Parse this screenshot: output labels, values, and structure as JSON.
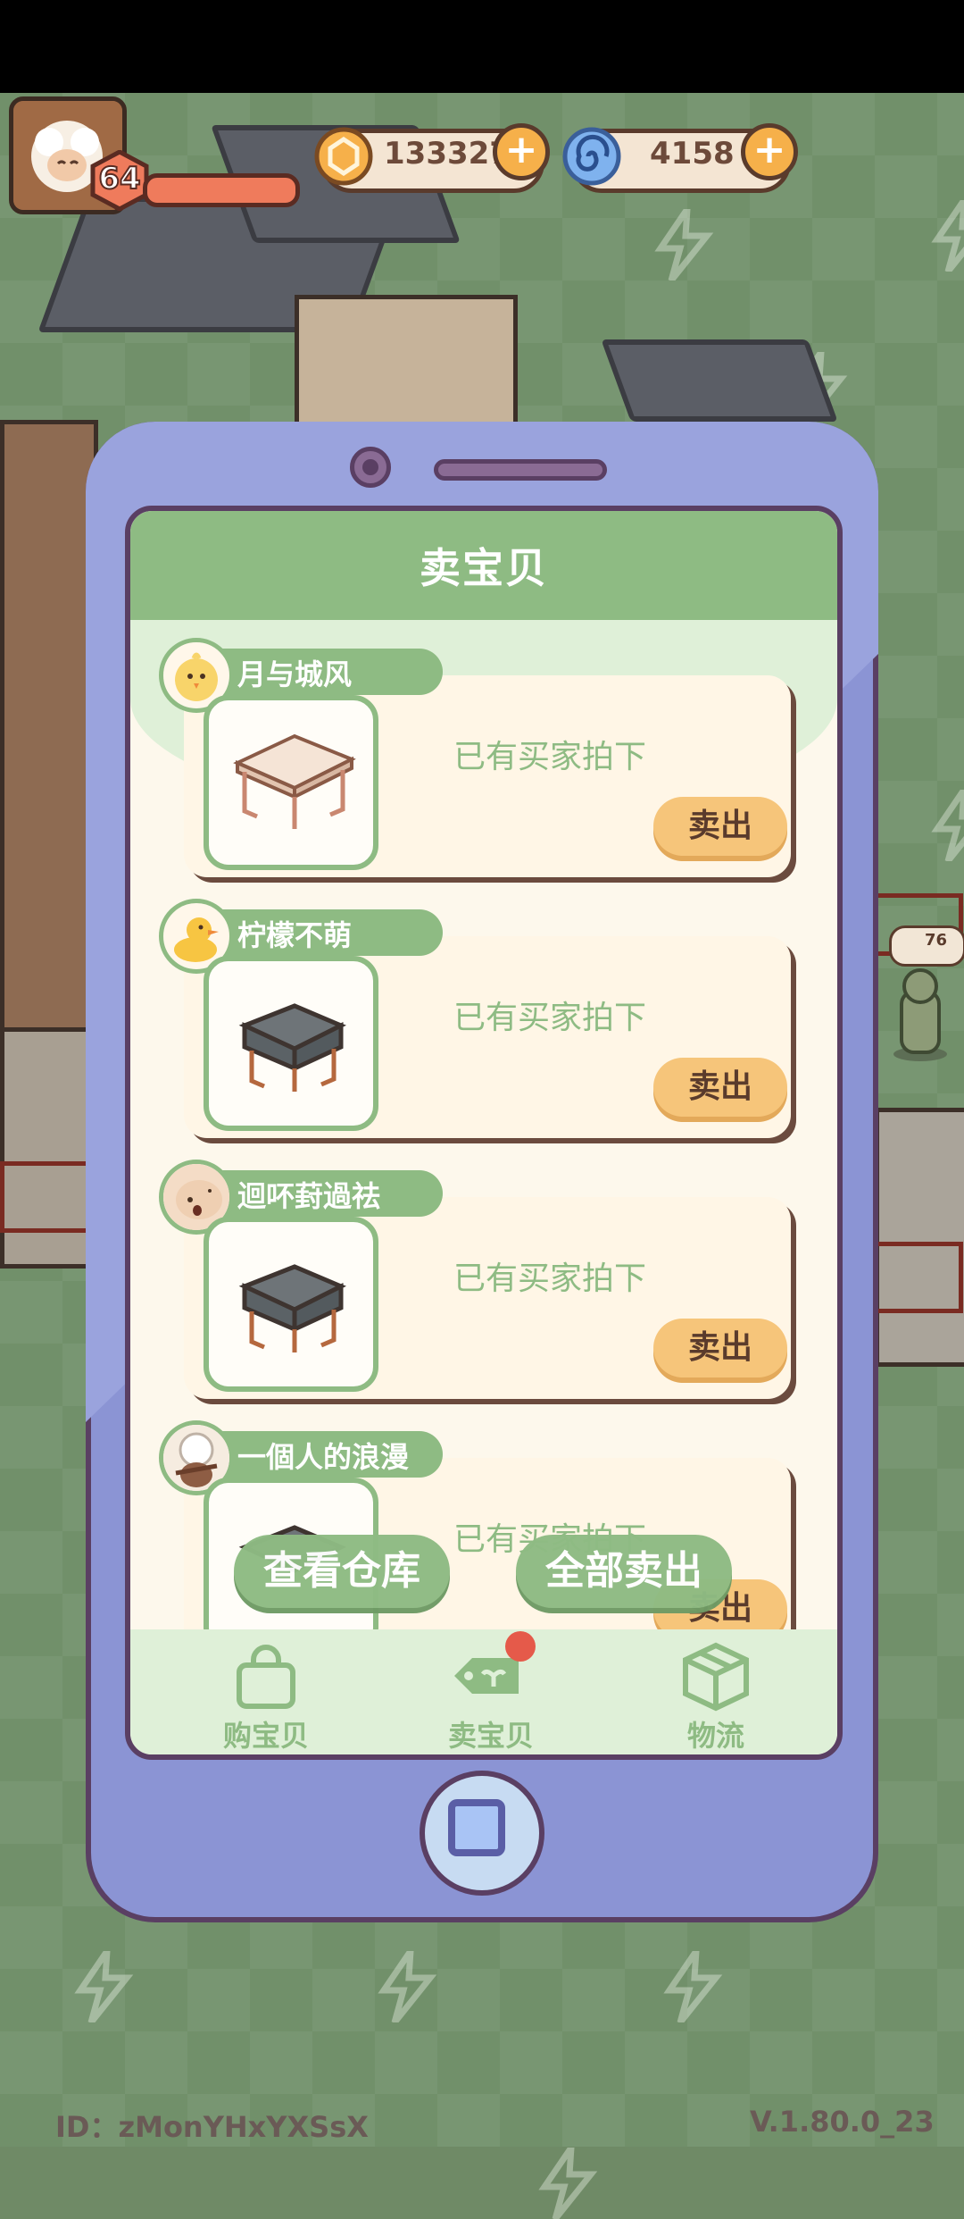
{
  "hud": {
    "player_level": "64",
    "coins": "133327",
    "gems": "4158"
  },
  "world": {
    "npc_bubble_count": "76"
  },
  "panel": {
    "title": "卖宝贝",
    "listings": [
      {
        "seller": "月与城风",
        "status": "已有买家拍下",
        "action": "卖出",
        "item_icon": "white-table-icon",
        "avatar_icon": "chick-avatar-icon"
      },
      {
        "seller": "柠檬不萌",
        "status": "已有买家拍下",
        "action": "卖出",
        "item_icon": "gray-stool-icon",
        "avatar_icon": "duck-avatar-icon"
      },
      {
        "seller": "迴吥葑過祛",
        "status": "已有买家拍下",
        "action": "卖出",
        "item_icon": "gray-stool-icon",
        "avatar_icon": "dog-avatar-icon"
      },
      {
        "seller": "一個人的浪漫",
        "status": "已有买家拍下",
        "action": "卖出",
        "item_icon": "gray-stool-icon",
        "avatar_icon": "sheep-avatar-icon"
      }
    ],
    "view_warehouse": "查看仓库",
    "sell_all": "全部卖出"
  },
  "nav": {
    "buy": "购宝贝",
    "sell": "卖宝贝",
    "logistics": "物流"
  },
  "footer": {
    "id_text": "ID：zMonYHxYXSsX",
    "version": "V.1.80.0_23"
  },
  "colors": {
    "accent_green": "#8ebb83",
    "phone_purple": "#8b94d4",
    "sell_orange": "#f6c57a"
  }
}
